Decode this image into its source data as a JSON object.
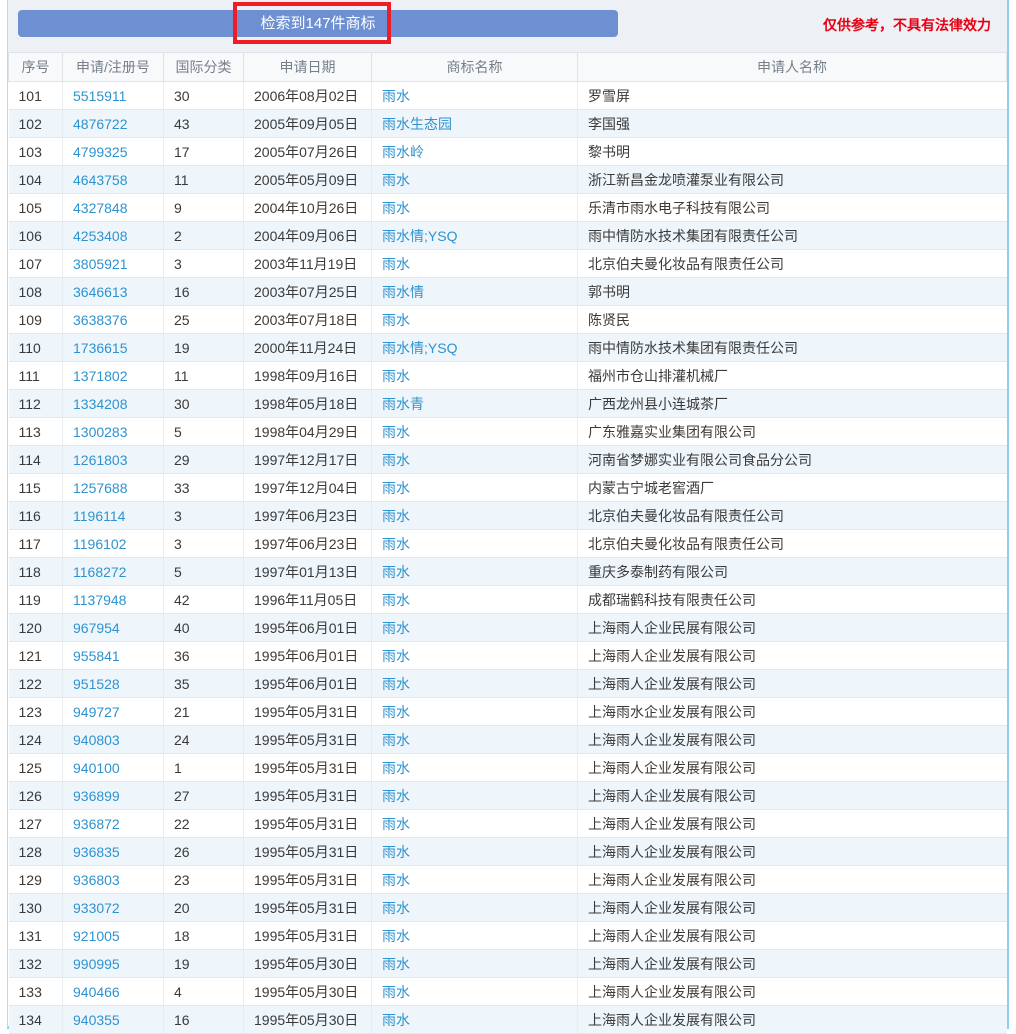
{
  "topbar": {
    "result_button_label": "检索到147件商标",
    "disclaimer": "仅供参考，不具有法律效力"
  },
  "table": {
    "columns": [
      "序号",
      "申请/注册号",
      "国际分类",
      "申请日期",
      "商标名称",
      "申请人名称"
    ],
    "rows": [
      [
        "101",
        "5515911",
        "30",
        "2006年08月02日",
        "雨水",
        "罗雪屏"
      ],
      [
        "102",
        "4876722",
        "43",
        "2005年09月05日",
        "雨水生态园",
        "李国强"
      ],
      [
        "103",
        "4799325",
        "17",
        "2005年07月26日",
        "雨水岭",
        "黎书明"
      ],
      [
        "104",
        "4643758",
        "11",
        "2005年05月09日",
        "雨水",
        "浙江新昌金龙喷灌泵业有限公司"
      ],
      [
        "105",
        "4327848",
        "9",
        "2004年10月26日",
        "雨水",
        "乐清市雨水电子科技有限公司"
      ],
      [
        "106",
        "4253408",
        "2",
        "2004年09月06日",
        "雨水情;YSQ",
        "雨中情防水技术集团有限责任公司"
      ],
      [
        "107",
        "3805921",
        "3",
        "2003年11月19日",
        "雨水",
        "北京伯夫曼化妆品有限责任公司"
      ],
      [
        "108",
        "3646613",
        "16",
        "2003年07月25日",
        "雨水情",
        "郭书明"
      ],
      [
        "109",
        "3638376",
        "25",
        "2003年07月18日",
        "雨水",
        "陈贤民"
      ],
      [
        "110",
        "1736615",
        "19",
        "2000年11月24日",
        "雨水情;YSQ",
        "雨中情防水技术集团有限责任公司"
      ],
      [
        "111",
        "1371802",
        "11",
        "1998年09月16日",
        "雨水",
        "福州市仓山排灌机械厂"
      ],
      [
        "112",
        "1334208",
        "30",
        "1998年05月18日",
        "雨水青",
        "广西龙州县小连城茶厂"
      ],
      [
        "113",
        "1300283",
        "5",
        "1998年04月29日",
        "雨水",
        "广东雅嘉实业集团有限公司"
      ],
      [
        "114",
        "1261803",
        "29",
        "1997年12月17日",
        "雨水",
        "河南省梦娜实业有限公司食品分公司"
      ],
      [
        "115",
        "1257688",
        "33",
        "1997年12月04日",
        "雨水",
        "内蒙古宁城老窖酒厂"
      ],
      [
        "116",
        "1196114",
        "3",
        "1997年06月23日",
        "雨水",
        "北京伯夫曼化妆品有限责任公司"
      ],
      [
        "117",
        "1196102",
        "3",
        "1997年06月23日",
        "雨水",
        "北京伯夫曼化妆品有限责任公司"
      ],
      [
        "118",
        "1168272",
        "5",
        "1997年01月13日",
        "雨水",
        "重庆多泰制药有限公司"
      ],
      [
        "119",
        "1137948",
        "42",
        "1996年11月05日",
        "雨水",
        "成都瑞鹤科技有限责任公司"
      ],
      [
        "120",
        "967954",
        "40",
        "1995年06月01日",
        "雨水",
        "上海雨人企业民展有限公司"
      ],
      [
        "121",
        "955841",
        "36",
        "1995年06月01日",
        "雨水",
        "上海雨人企业发展有限公司"
      ],
      [
        "122",
        "951528",
        "35",
        "1995年06月01日",
        "雨水",
        "上海雨人企业发展有限公司"
      ],
      [
        "123",
        "949727",
        "21",
        "1995年05月31日",
        "雨水",
        "上海雨水企业发展有限公司"
      ],
      [
        "124",
        "940803",
        "24",
        "1995年05月31日",
        "雨水",
        "上海雨人企业发展有限公司"
      ],
      [
        "125",
        "940100",
        "1",
        "1995年05月31日",
        "雨水",
        "上海雨人企业发展有限公司"
      ],
      [
        "126",
        "936899",
        "27",
        "1995年05月31日",
        "雨水",
        "上海雨人企业发展有限公司"
      ],
      [
        "127",
        "936872",
        "22",
        "1995年05月31日",
        "雨水",
        "上海雨人企业发展有限公司"
      ],
      [
        "128",
        "936835",
        "26",
        "1995年05月31日",
        "雨水",
        "上海雨人企业发展有限公司"
      ],
      [
        "129",
        "936803",
        "23",
        "1995年05月31日",
        "雨水",
        "上海雨人企业发展有限公司"
      ],
      [
        "130",
        "933072",
        "20",
        "1995年05月31日",
        "雨水",
        "上海雨人企业发展有限公司"
      ],
      [
        "131",
        "921005",
        "18",
        "1995年05月31日",
        "雨水",
        "上海雨人企业发展有限公司"
      ],
      [
        "132",
        "990995",
        "19",
        "1995年05月30日",
        "雨水",
        "上海雨人企业发展有限公司"
      ],
      [
        "133",
        "940466",
        "4",
        "1995年05月30日",
        "雨水",
        "上海雨人企业发展有限公司"
      ],
      [
        "134",
        "940355",
        "16",
        "1995年05月30日",
        "雨水",
        "上海雨人企业发展有限公司"
      ]
    ]
  },
  "colors": {
    "button_blue": "#6e90d3",
    "annotation_red": "#ee1c24",
    "disclaimer_red": "#e60012",
    "link_blue": "#2e93d0",
    "alt_row_bg": "#eff6fb",
    "edge_blue": "#8ecff0"
  }
}
